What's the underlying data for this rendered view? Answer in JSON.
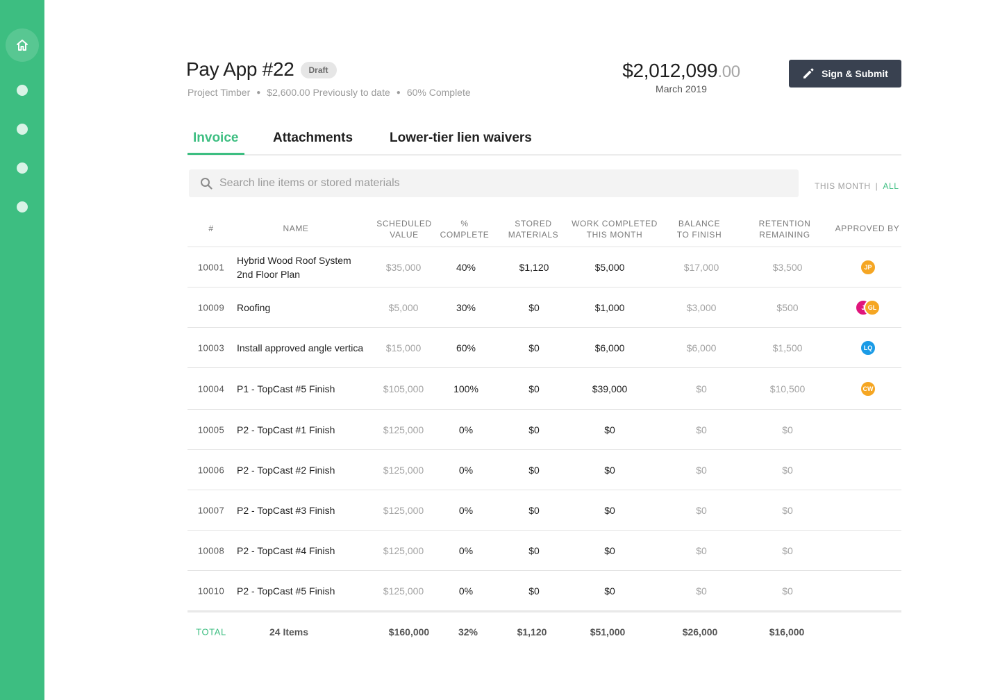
{
  "sidebar": {
    "home_icon": "home-icon",
    "dots": [
      "nav-dot",
      "nav-dot",
      "nav-dot",
      "nav-dot"
    ]
  },
  "header": {
    "title": "Pay App #22",
    "badge": "Draft",
    "project": "Project Timber",
    "previously": "$2,600.00 Previously to date",
    "complete": "60% Complete",
    "amount_main": "$2,012,099",
    "amount_cents": ".00",
    "amount_date": "March 2019",
    "submit_label": "Sign & Submit"
  },
  "tabs": [
    "Invoice",
    "Attachments",
    "Lower-tier lien waivers"
  ],
  "search": {
    "placeholder": "Search line items or stored materials"
  },
  "filter": {
    "this_month": "THIS MONTH",
    "separator": "|",
    "all": "ALL"
  },
  "table": {
    "headers": [
      "#",
      "NAME",
      "SCHEDULED",
      "VALUE",
      "%",
      "COMPLETE",
      "STORED",
      "MATERIALS",
      "WORK COMPLETED",
      "THIS MONTH",
      "BALANCE",
      "TO FINISH",
      "RETENTION",
      "REMAINING",
      "APPROVED BY"
    ],
    "rows": [
      {
        "num": "10001",
        "name": "Hybrid Wood Roof System 2nd Floor Plan",
        "scheduled": "$35,000",
        "pct": "40%",
        "stored": "$1,120",
        "work": "$5,000",
        "balance": "$17,000",
        "retention": "$3,500",
        "approvers": [
          {
            "initials": "JP",
            "color": "#f5a623"
          }
        ]
      },
      {
        "num": "10009",
        "name": "Roofing",
        "scheduled": "$5,000",
        "pct": "30%",
        "stored": "$0",
        "work": "$1,000",
        "balance": "$3,000",
        "retention": "$500",
        "approvers": [
          {
            "initials": "J",
            "color": "#e0157c"
          },
          {
            "initials": "GL",
            "color": "#f5a623"
          }
        ]
      },
      {
        "num": "10003",
        "name": "Install approved angle vertica",
        "scheduled": "$15,000",
        "pct": "60%",
        "stored": "$0",
        "work": "$6,000",
        "balance": "$6,000",
        "retention": "$1,500",
        "approvers": [
          {
            "initials": "LQ",
            "color": "#1b9be6"
          }
        ]
      },
      {
        "num": "10004",
        "name": "P1 - TopCast #5 Finish",
        "scheduled": "$105,000",
        "pct": "100%",
        "stored": "$0",
        "work": "$39,000",
        "balance": "$0",
        "retention": "$10,500",
        "approvers": [
          {
            "initials": "CW",
            "color": "#f5a623"
          }
        ]
      },
      {
        "num": "10005",
        "name": "P2 - TopCast #1 Finish",
        "scheduled": "$125,000",
        "pct": "0%",
        "stored": "$0",
        "work": "$0",
        "balance": "$0",
        "retention": "$0",
        "approvers": []
      },
      {
        "num": "10006",
        "name": "P2 - TopCast #2 Finish",
        "scheduled": "$125,000",
        "pct": "0%",
        "stored": "$0",
        "work": "$0",
        "balance": "$0",
        "retention": "$0",
        "approvers": []
      },
      {
        "num": "10007",
        "name": "P2 - TopCast #3 Finish",
        "scheduled": "$125,000",
        "pct": "0%",
        "stored": "$0",
        "work": "$0",
        "balance": "$0",
        "retention": "$0",
        "approvers": []
      },
      {
        "num": "10008",
        "name": "P2 - TopCast #4 Finish",
        "scheduled": "$125,000",
        "pct": "0%",
        "stored": "$0",
        "work": "$0",
        "balance": "$0",
        "retention": "$0",
        "approvers": []
      },
      {
        "num": "10010",
        "name": "P2 - TopCast #5 Finish",
        "scheduled": "$125,000",
        "pct": "0%",
        "stored": "$0",
        "work": "$0",
        "balance": "$0",
        "retention": "$0",
        "approvers": []
      }
    ],
    "total": {
      "label": "TOTAL",
      "items": "24 Items",
      "scheduled": "$160,000",
      "pct": "32%",
      "stored": "$1,120",
      "work": "$51,000",
      "balance": "$26,000",
      "retention": "$16,000"
    }
  },
  "colors": {
    "accent": "#3dbe81",
    "button": "#394150"
  }
}
